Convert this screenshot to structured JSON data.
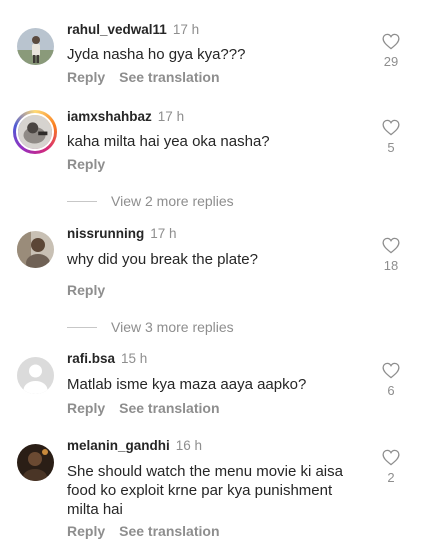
{
  "comments": [
    {
      "username": "rahul_vedwal11",
      "time": "17 h",
      "text": "Jyda nasha ho gya kya???",
      "reply_label": "Reply",
      "translation_label": "See translation",
      "likes": "29",
      "avatar_icon": "profile-photo-outdoor"
    },
    {
      "username": "iamxshahbaz",
      "time": "17 h",
      "text": "kaha milta hai yea oka nasha?",
      "reply_label": "Reply",
      "likes": "5",
      "avatar_icon": "profile-photo-story-ring"
    },
    {
      "username": "nissrunning",
      "time": "17 h",
      "text": "why did you break the plate?",
      "reply_label": "Reply",
      "likes": "18",
      "avatar_icon": "profile-photo"
    },
    {
      "username": "rafi.bsa",
      "time": "15 h",
      "text": "Matlab isme kya maza aaya aapko?",
      "reply_label": "Reply",
      "translation_label": "See translation",
      "likes": "6",
      "avatar_icon": "default-avatar"
    },
    {
      "username": "melanin_gandhi",
      "time": "16 h",
      "text_lines": [
        "She should watch the menu movie ki aisa",
        "food ko exploit krne par kya punishment",
        "milta hai"
      ],
      "reply_label": "Reply",
      "translation_label": "See translation",
      "likes": "2",
      "avatar_icon": "profile-photo-dark"
    }
  ],
  "view_more": [
    {
      "label": "View 2 more replies"
    },
    {
      "label": "View 3 more replies"
    }
  ],
  "colors": {
    "text": "#262626",
    "secondary": "#8e8e8e",
    "divider": "#c7c7c7"
  },
  "icons": {
    "like": "heart-outline-icon"
  }
}
